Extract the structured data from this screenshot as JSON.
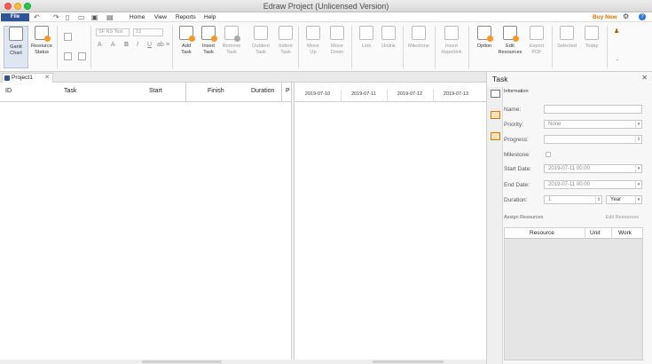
{
  "window": {
    "title": "Edraw Project (Unlicensed Version)"
  },
  "menubar": {
    "file_label": "File",
    "items": [
      "Home",
      "View",
      "Reports",
      "Help"
    ],
    "buy_now": "Buy Now",
    "gear_glyph": "⚙",
    "help_glyph": "?"
  },
  "ribbon": {
    "gantt_chart": "Gantt\nChart",
    "resource_status": "Resource\nStatus",
    "font_name": "SF NS Text",
    "font_size": "13",
    "format_glyphs": [
      "A",
      "A",
      "B",
      "I",
      "U",
      "ab",
      "≡"
    ],
    "add_task": "Add\nTask",
    "insert_task": "Insert\nTask",
    "remove_task": "Remove\nTask",
    "outdent_task": "Outdent\nTask",
    "indent_task": "Indent\nTask",
    "move_up": "Move\nUp",
    "move_down": "Move\nDown",
    "link": "Link",
    "unlink": "Unlink",
    "milestone": "Milestone",
    "insert_hyperlink": "Insert\nHyperlink",
    "option": "Option",
    "edit_resources": "Edit\nResources",
    "export_pdf": "Export\nPDF",
    "selected": "Selected",
    "today": "Today",
    "more": "-"
  },
  "tabs": {
    "doc_tab": "Project1",
    "close": "✕"
  },
  "grid": {
    "columns": [
      "ID",
      "Task",
      "Start",
      "Finish",
      "Duration",
      "P"
    ],
    "gantt_dates": [
      "2019-07-10",
      "2019-07-11",
      "2019-07-12",
      "2019-07-13"
    ]
  },
  "task_panel": {
    "title": "Task",
    "close": "✕",
    "information": "Information",
    "name_label": "Name:",
    "name_value": "",
    "priority_label": "Priority:",
    "priority_value": "None",
    "progress_label": "Progress:",
    "progress_value": "",
    "milestone_label": "Milestone:",
    "start_label": "Start Date:",
    "start_value": "2019-07-11      00:00",
    "end_label": "End Date:",
    "end_value": "2019-07-11      00:00",
    "duration_label": "Duration:",
    "duration_value": "1",
    "duration_unit": "Year",
    "assign_resources": "Assign Resources",
    "edit_resources": "Edit Resources",
    "res_columns": [
      "Resource",
      "Unit",
      "Work"
    ]
  }
}
